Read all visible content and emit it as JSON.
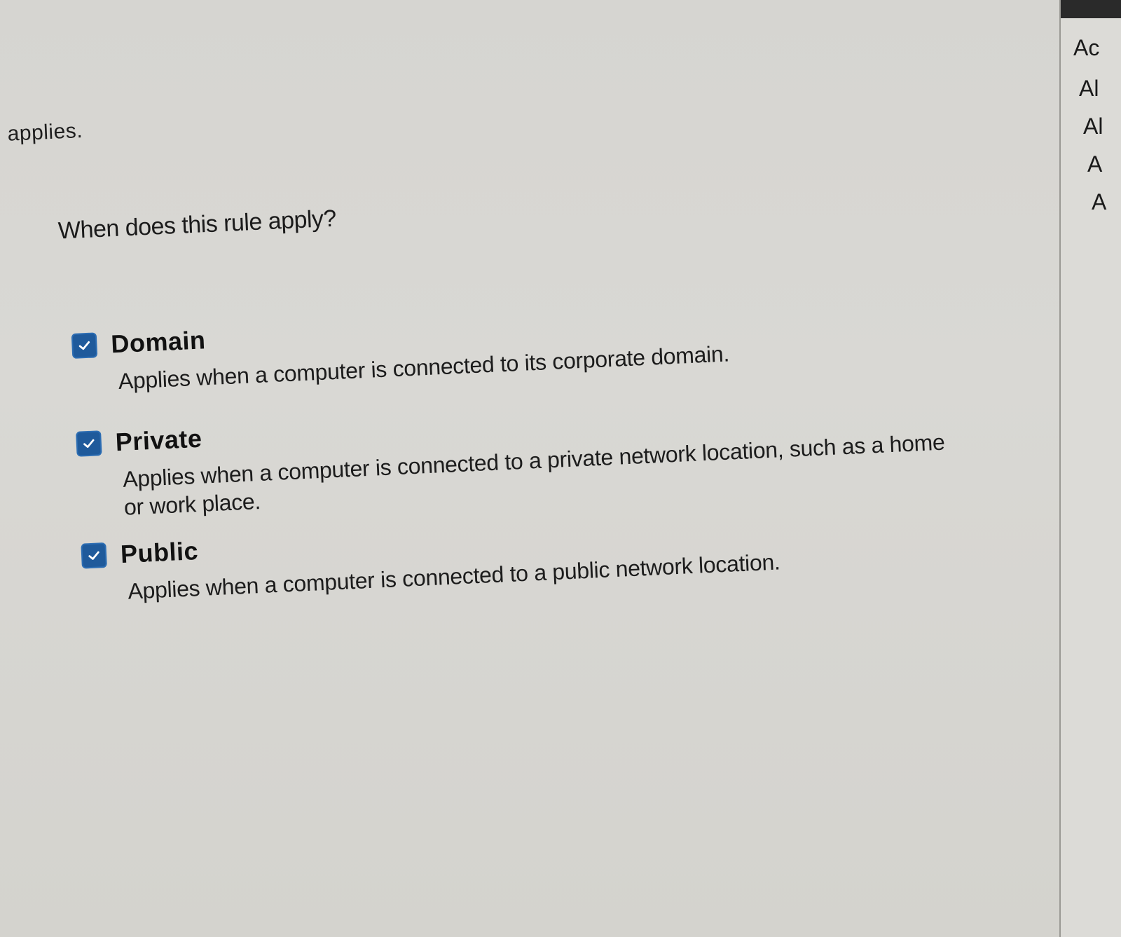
{
  "rule_scope": {
    "truncated_text": "applies.",
    "question": "When does this rule apply?",
    "options": [
      {
        "label": "Domain",
        "checked": true,
        "description": "Applies when a computer is connected to its corporate domain."
      },
      {
        "label": "Private",
        "checked": true,
        "description": "Applies when a computer is connected to a private network location, such as a home or work place."
      },
      {
        "label": "Public",
        "checked": true,
        "description": "Applies when a computer is connected to a public network location."
      }
    ]
  },
  "actions_panel": {
    "items": [
      "Ac",
      "Al",
      "Al",
      "A",
      "A"
    ]
  },
  "colors": {
    "checkbox_fill": "#1f5a9b",
    "background": "#d6d5d1"
  },
  "icons": {
    "checkbox_mark": "check-icon"
  }
}
